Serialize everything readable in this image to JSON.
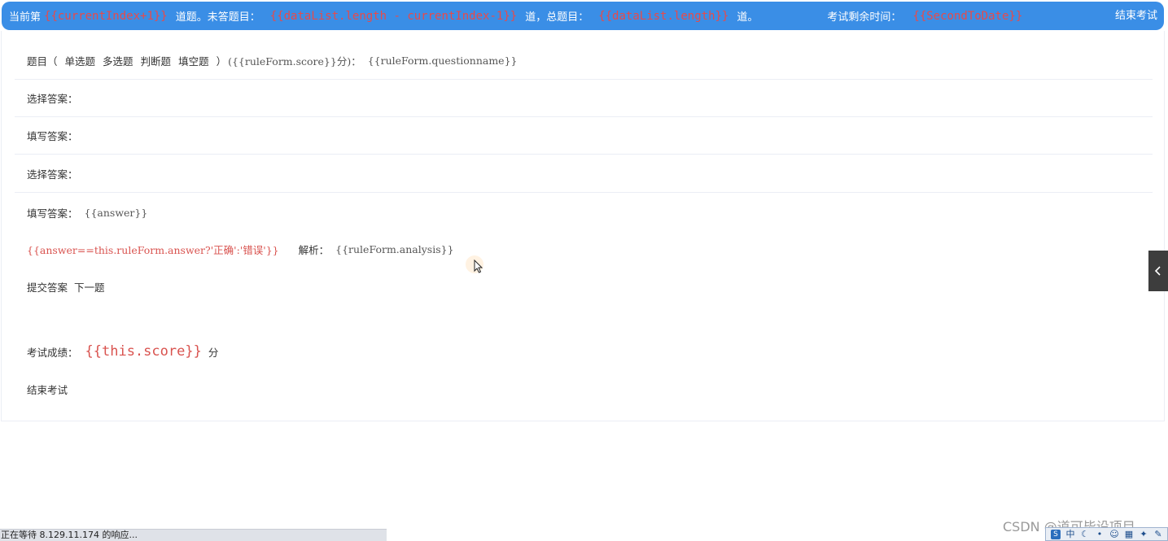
{
  "topbar": {
    "prefix": "当前第",
    "current_expr": "{{currentIndex+1}}",
    "unanswered_label": "道题。未答题目：",
    "unanswered_expr": "{{dataList.length - currentIndex-1}}",
    "total_label": "道，总题目：",
    "total_expr": "{{dataList.length}}",
    "suffix": "道。",
    "time_label": "考试剩余时间：",
    "time_expr": "{{SecondToDate}}",
    "end_button": "结束考试"
  },
  "question": {
    "prefix": "题目（",
    "types": [
      "单选题",
      "多选题",
      "判断题",
      "填空题"
    ],
    "close": "）",
    "score_expr": "({{ruleForm.score}}分)：",
    "name_expr": "{{ruleForm.questionname}}"
  },
  "rows": {
    "choose_answer_1": "选择答案：",
    "fill_answer_1": "填写答案：",
    "choose_answer_2": "选择答案：",
    "fill_answer_2_label": "填写答案：",
    "fill_answer_2_expr": "{{answer}}"
  },
  "result": {
    "correct_expr": "{{answer==this.ruleForm.answer?'正确':'错误'}}",
    "analysis_label": "解析：",
    "analysis_expr": "{{ruleForm.analysis}}"
  },
  "actions": {
    "submit": "提交答案",
    "next": "下一题"
  },
  "score": {
    "label": "考试成绩：",
    "expr": "{{this.score}}",
    "unit": "分"
  },
  "end_exam": "结束考试",
  "status_bar": "正在等待 8.129.11.174 的响应...",
  "watermark": "CSDN @道可毕设项目",
  "tray": [
    "中"
  ],
  "colors": {
    "topbar": "#3a8ee6",
    "accent_red": "#d9534f",
    "divider": "#ebeef5"
  },
  "icons": {
    "side_tab": "chevron-left-icon"
  }
}
